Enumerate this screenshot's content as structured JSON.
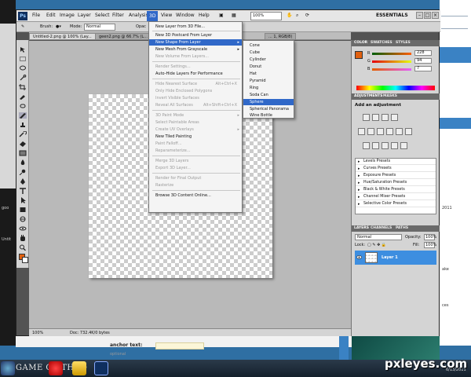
{
  "menubar": {
    "logo": "Ps",
    "items": [
      "File",
      "Edit",
      "Image",
      "Layer",
      "Select",
      "Filter",
      "Analysis",
      "3D",
      "View",
      "Window",
      "Help"
    ],
    "active": "3D",
    "zoom": "100%",
    "workspace": "ESSENTIALS"
  },
  "options_bar": {
    "brush_label": "Brush:",
    "mode_label": "Mode:",
    "mode_value": "Normal",
    "opacity_label": "Opac"
  },
  "doc_tabs": [
    "Untitled-2.png @ 100% (Lay...",
    "geen2.png @ 66.7% (L...",
    "... 1, RGB/8)"
  ],
  "menu_3d": {
    "items": [
      {
        "label": "New Layer from 3D File...",
        "disabled": false
      },
      {
        "sep": true
      },
      {
        "label": "New 3D Postcard From Layer",
        "disabled": false
      },
      {
        "label": "New Shape From Layer",
        "disabled": false,
        "submenu": true,
        "highlight": true
      },
      {
        "label": "New Mesh From Grayscale",
        "disabled": false,
        "submenu": true
      },
      {
        "label": "New Volume From Layers...",
        "disabled": true
      },
      {
        "sep": true
      },
      {
        "label": "Render Settings...",
        "disabled": true
      },
      {
        "label": "Auto-Hide Layers For Performance",
        "disabled": false
      },
      {
        "sep": true
      },
      {
        "label": "Hide Nearest Surface",
        "disabled": true,
        "shortcut": "Alt+Ctrl+X"
      },
      {
        "label": "Only Hide Enclosed Polygons",
        "disabled": true
      },
      {
        "label": "Invert Visible Surfaces",
        "disabled": true
      },
      {
        "label": "Reveal All Surfaces",
        "disabled": true,
        "shortcut": "Alt+Shift+Ctrl+X"
      },
      {
        "sep": true
      },
      {
        "label": "3D Paint Mode",
        "disabled": true,
        "submenu": true
      },
      {
        "label": "Select Paintable Areas",
        "disabled": true
      },
      {
        "label": "Create UV Overlays",
        "disabled": true,
        "submenu": true
      },
      {
        "label": "New Tiled Painting",
        "disabled": false
      },
      {
        "label": "Paint Falloff...",
        "disabled": true
      },
      {
        "label": "Reparameterize...",
        "disabled": true
      },
      {
        "sep": true
      },
      {
        "label": "Merge 3D Layers",
        "disabled": true
      },
      {
        "label": "Export 3D Layer...",
        "disabled": true
      },
      {
        "sep": true
      },
      {
        "label": "Render for Final Output",
        "disabled": true
      },
      {
        "label": "Rasterize",
        "disabled": true
      },
      {
        "sep": true
      },
      {
        "label": "Browse 3D Content Online...",
        "disabled": false
      }
    ]
  },
  "submenu_shapes": {
    "items": [
      "Cone",
      "Cube",
      "Cylinder",
      "Donut",
      "Hat",
      "Pyramid",
      "Ring",
      "Soda Can",
      "Sphere",
      "Spherical Panorama",
      "Wine Bottle"
    ],
    "highlight": "Sphere"
  },
  "color_panel": {
    "tabs": [
      "COLOR",
      "SWATCHES",
      "STYLES"
    ],
    "r_label": "R",
    "g_label": "G",
    "b_label": "B",
    "r": "228",
    "g": "94",
    "b": "7",
    "fg_color": "#e45e07"
  },
  "adjustments_panel": {
    "tabs": [
      "ADJUSTMENTS",
      "MASKS"
    ],
    "title": "Add an adjustment",
    "presets": [
      "Levels Presets",
      "Curves Presets",
      "Exposure Presets",
      "Hue/Saturation Presets",
      "Black & White Presets",
      "Channel Mixer Presets",
      "Selective Color Presets"
    ]
  },
  "layers_panel": {
    "tabs": [
      "LAYERS",
      "CHANNELS",
      "PATHS"
    ],
    "blend_mode": "Normal",
    "opacity_label": "Opacity:",
    "opacity": "100%",
    "lock_label": "Lock:",
    "fill_label": "Fill:",
    "fill": "100%",
    "layer_name": "Layer 1"
  },
  "status": {
    "zoom": "100%",
    "doc": "Doc: 732.4K/0 bytes"
  },
  "background_page": {
    "anchor_label": "anchor text:",
    "optional": "optional",
    "left_text_1": "goo",
    "left_text_2": "Untit",
    "right_text_1": "ake",
    "right_text_2": "ces",
    "right_date": "2011"
  },
  "taskbar": {
    "title_text": "GAME OF THRO",
    "clock": "6/13/2011"
  },
  "watermark": "pxleyes.com"
}
